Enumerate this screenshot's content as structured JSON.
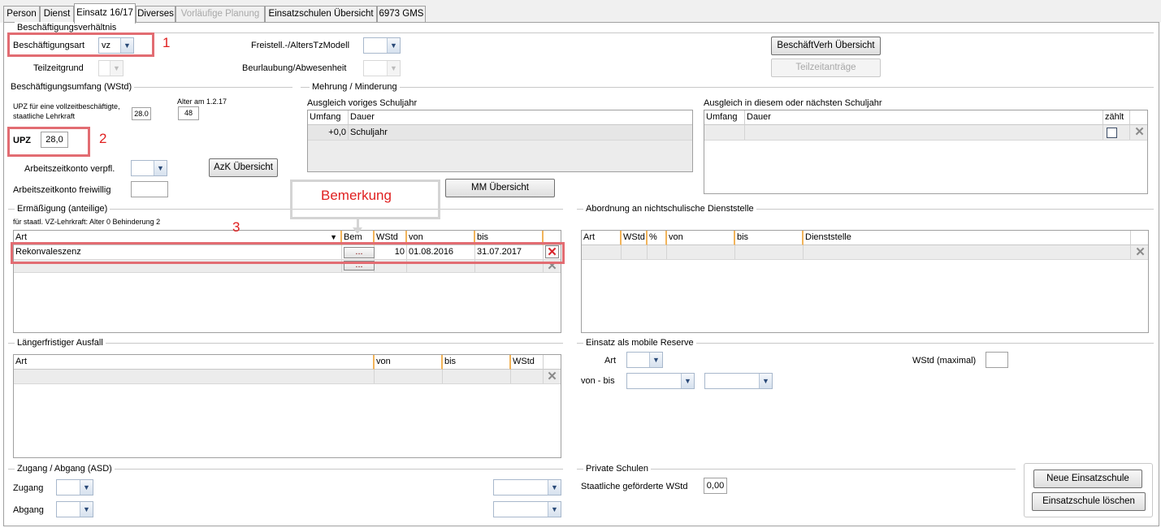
{
  "tabs": [
    {
      "label": "Person",
      "state": "normal"
    },
    {
      "label": "Dienst",
      "state": "normal"
    },
    {
      "label": "Einsatz 16/17",
      "state": "active"
    },
    {
      "label": "Diverses",
      "state": "normal"
    },
    {
      "label": "Vorläufige Planung",
      "state": "disabled"
    },
    {
      "label": "Einsatzschulen Übersicht",
      "state": "normal"
    },
    {
      "label": "6973 GMS",
      "state": "normal"
    }
  ],
  "beschaeftigung": {
    "legend": "Beschäftigungsverhältnis",
    "art_label": "Beschäftigungsart",
    "art_value": "vz",
    "teilzeitgrund_label": "Teilzeitgrund",
    "teilzeitgrund_value": "",
    "freistell_label": "Freistell.-/AltersTzModell",
    "freistell_value": "",
    "beurlaubung_label": "Beurlaubung/Abwesenheit",
    "beurlaubung_value": "",
    "uebersicht_button": "BeschäftVerh Übersicht",
    "teilzeitantraege_button": "Teilzeitanträge"
  },
  "umfang": {
    "legend": "Beschäftigungsumfang (WStd)",
    "upz_note": "UPZ für eine vollzeitbeschäftigte, staatliche Lehrkraft",
    "upz_note_value": "28.0",
    "alter_label": "Alter am 1.2.17",
    "alter_value": "48",
    "upz_label": "UPZ",
    "upz_value": "28,0",
    "azk_verpfl_label": "Arbeitszeitkonto verpfl.",
    "azk_verpfl_value": "",
    "azk_button": "AzK Übersicht",
    "azk_freiwillig_label": "Arbeitszeitkonto freiwillig",
    "azk_freiwillig_value": ""
  },
  "mehrung": {
    "legend": "Mehrung / Minderung",
    "vorjahr_title": "Ausgleich voriges Schuljahr",
    "vorjahr_cols": [
      "Umfang",
      "Dauer"
    ],
    "vorjahr_row": {
      "umfang": "+0,0",
      "dauer": "Schuljahr"
    },
    "naechstes_title": "Ausgleich in diesem oder nächsten Schuljahr",
    "naechstes_cols": [
      "Umfang",
      "Dauer",
      "zählt"
    ],
    "mm_button": "MM Übersicht"
  },
  "ermaessigung": {
    "legend": "Ermäßigung (anteilige)",
    "note": "für staatl. VZ-Lehrkraft: Alter 0 Behinderung 2",
    "cols": [
      "Art",
      "Bem",
      "WStd",
      "von",
      "bis"
    ],
    "rows": [
      {
        "art": "Rekonvaleszenz",
        "bem": "...",
        "wstd": "10",
        "von": "01.08.2016",
        "bis": "31.07.2017"
      },
      {
        "art": "",
        "bem": "...",
        "wstd": "",
        "von": "",
        "bis": ""
      }
    ]
  },
  "abordnung": {
    "legend": "Abordnung an nichtschulische Dienststelle",
    "cols": [
      "Art",
      "WStd",
      "%",
      "von",
      "bis",
      "Dienststelle"
    ]
  },
  "ausfall": {
    "legend": "Längerfristiger Ausfall",
    "cols": [
      "Art",
      "von",
      "bis",
      "WStd"
    ]
  },
  "reserve": {
    "legend": "Einsatz als mobile Reserve",
    "art_label": "Art",
    "art_value": "",
    "wstd_label": "WStd (maximal)",
    "wstd_value": "",
    "vonbis_label": "von - bis",
    "von_value": "",
    "bis_value": ""
  },
  "zugang": {
    "legend": "Zugang / Abgang (ASD)",
    "zugang_label": "Zugang",
    "zugang_value": "",
    "zugang_date": "",
    "abgang_label": "Abgang",
    "abgang_value": "",
    "abgang_date": ""
  },
  "privat": {
    "legend": "Private Schulen",
    "gefoerdert_label": "Staatliche geförderte WStd",
    "gefoerdert_value": "0,00"
  },
  "actions": {
    "neue_button": "Neue Einsatzschule",
    "loeschen_button": "Einsatzschule löschen"
  },
  "annotations": {
    "n1": "1",
    "n2": "2",
    "n3": "3",
    "bemerkung": "Bemerkung",
    "color": "#e26c72"
  }
}
